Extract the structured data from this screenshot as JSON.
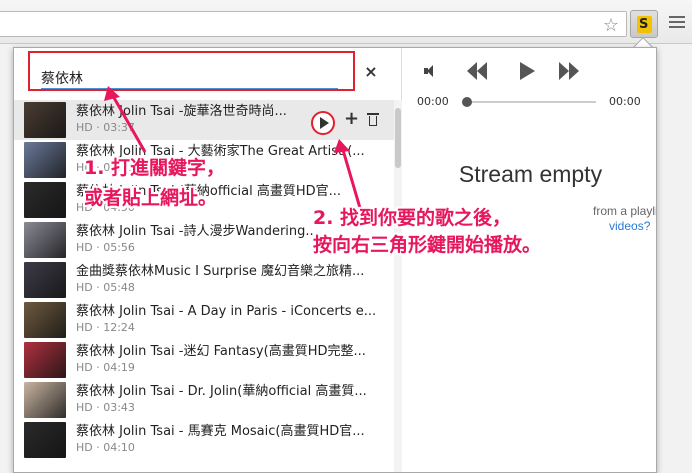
{
  "search": {
    "value": "蔡依林",
    "clear_icon": "×"
  },
  "results": [
    {
      "title": "蔡依林 Jolin Tsai -旋華洛世奇時尚...",
      "meta": "HD · 03:37",
      "thumb": "#4a3d32"
    },
    {
      "title": "蔡依林 Jolin Tsai - 大藝術家The Great Artist (...",
      "meta": "HD · 04:51",
      "thumb": "#6b7a9a"
    },
    {
      "title": "蔡依林 Jolin Tsai (華納official 高畫質HD官...",
      "meta": "HD · 04:50",
      "thumb": "#2b2b2b"
    },
    {
      "title": "蔡依林 Jolin Tsai -詩人漫步Wandering...",
      "meta": "HD · 05:56",
      "thumb": "#8a8a96"
    },
    {
      "title": "金曲獎蔡依林Music I Surprise 魔幻音樂之旅精...",
      "meta": "HD · 05:48",
      "thumb": "#3e3b48"
    },
    {
      "title": "蔡依林 Jolin Tsai - A Day in Paris - iConcerts e...",
      "meta": "HD · 12:24",
      "thumb": "#6d5a3f"
    },
    {
      "title": "蔡依林 Jolin Tsai -迷幻 Fantasy(高畫質HD完整...",
      "meta": "HD · 04:19",
      "thumb": "#b03040"
    },
    {
      "title": "蔡依林 Jolin Tsai - Dr. Jolin(華納official 高畫質...",
      "meta": "HD · 03:43",
      "thumb": "#c9b5a2"
    },
    {
      "title": "蔡依林 Jolin Tsai - 馬賽克 Mosaic(高畫質HD官...",
      "meta": "HD · 04:10",
      "thumb": "#2a2a2a"
    }
  ],
  "player": {
    "time_current": "00:00",
    "time_total": "00:00"
  },
  "stream": {
    "title": "Stream empty",
    "hint_line1": "from a playlist or",
    "hint_line2": "videos?"
  },
  "annotations": {
    "step1_line1": "1. 打進關鍵字，",
    "step1_line2": "或者貼上網址。",
    "step2_line1": "2. 找到你要的歌之後，",
    "step2_line2": "按向右三角形鍵開始播放。"
  },
  "colors": {
    "annotation": "#e8175d",
    "highlight_box": "#e0212e",
    "link": "#2a7ad5"
  }
}
